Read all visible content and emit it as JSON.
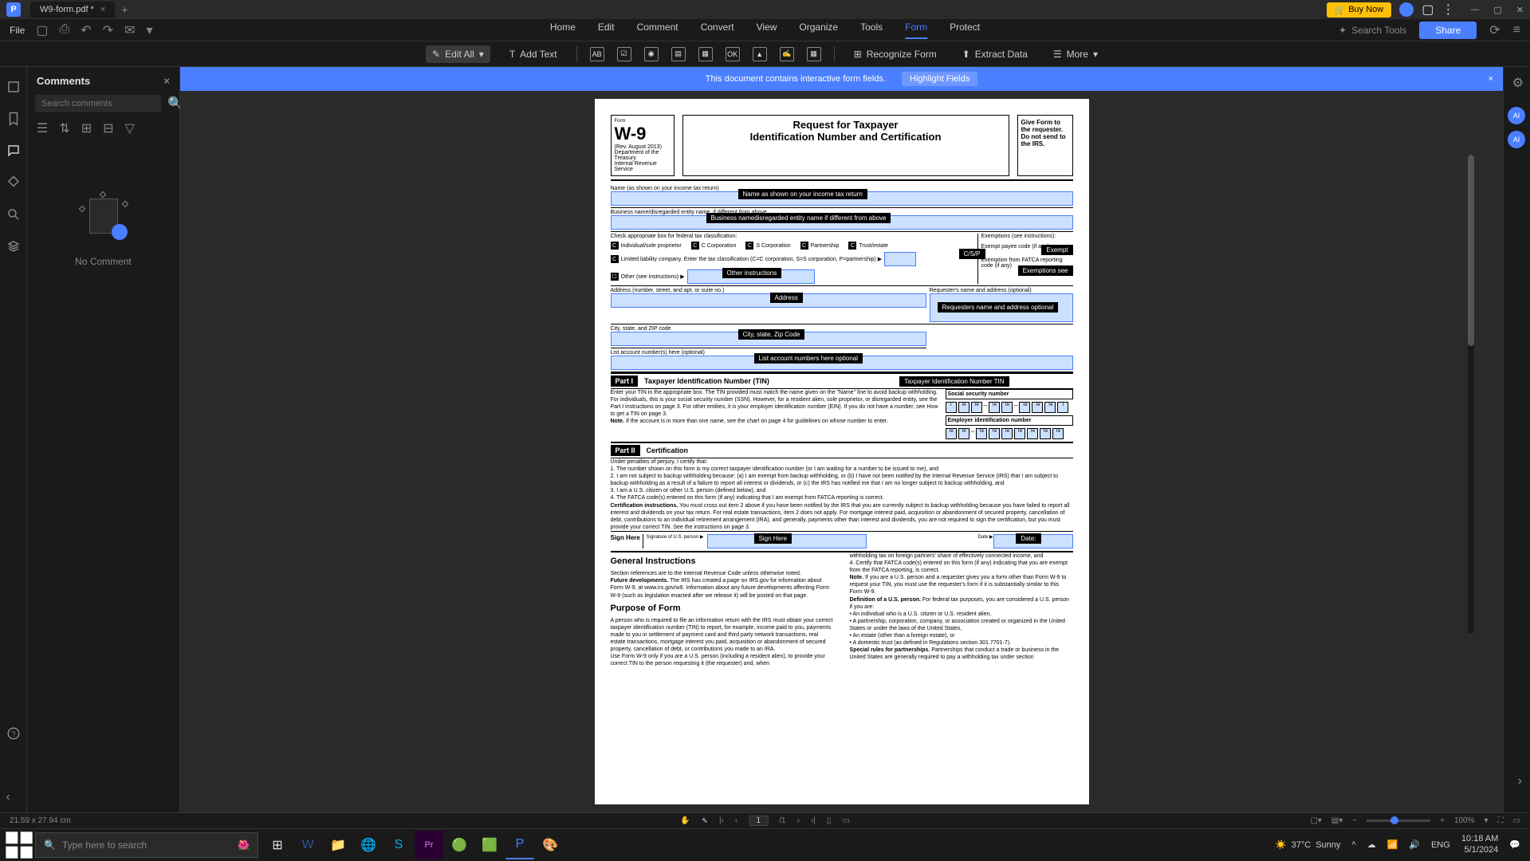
{
  "app": {
    "name": "P"
  },
  "tab": {
    "title": "W9-form.pdf *"
  },
  "titlebar": {
    "buy_now": "Buy Now"
  },
  "menu": {
    "file": "File",
    "items": [
      "Home",
      "Edit",
      "Comment",
      "Convert",
      "View",
      "Organize",
      "Tools",
      "Form",
      "Protect"
    ],
    "search": "Search Tools",
    "share": "Share"
  },
  "toolbar": {
    "edit_all": "Edit All",
    "add_text": "Add Text",
    "recognize": "Recognize Form",
    "extract": "Extract Data",
    "more": "More"
  },
  "comments": {
    "title": "Comments",
    "search_placeholder": "Search comments",
    "empty": "No Comment"
  },
  "banner": {
    "text": "This document contains interactive form fields.",
    "highlight": "Highlight Fields"
  },
  "w9": {
    "form_label": "Form",
    "title": "W-9",
    "rev": "(Rev. August 2013)",
    "dept": "Department of the Treasury",
    "irs": "Internal Revenue Service",
    "request_title": "Request for Taxpayer",
    "request_sub": "Identification Number and Certification",
    "give_form": "Give Form to the requester. Do not send to the IRS.",
    "name_label": "Name (as shown on your income tax return)",
    "name_tooltip": "Name as shown on your income tax return",
    "business_label": "Business name/disregarded entity name, if different from above",
    "business_tooltip": "Business namedisregarded entity name if different from above",
    "check_label": "Check appropriate box for federal tax classification:",
    "cb_individual": "Individual/sole proprietor",
    "cb_ccorp": "C Corporation",
    "cb_scorp": "S Corporation",
    "cb_partnership": "Partnership",
    "cb_trust": "Trust/estate",
    "exemptions": "Exemptions (see instructions):",
    "exempt_payee": "Exempt payee code (if any)",
    "exempt_tooltip": "Exempt",
    "llc_label": "Limited liability company. Enter the tax classification (C=C corporation, S=S corporation, P=partnership) ▶",
    "csp_tooltip": "C/S/P",
    "fatca": "Exemption from FATCA reporting code (if any)",
    "fatca_tooltip": "Exemptions see",
    "other_label": "Other (see instructions) ▶",
    "other_tooltip": "Other instructions",
    "address_label": "Address (number, street, and apt. or suite no.)",
    "address_tooltip": "Address",
    "requester_label": "Requester's name and address (optional)",
    "requester_tooltip": "Requesters name and address optional",
    "city_label": "City, state, and ZIP code",
    "city_tooltip": "City, state, Zip Code",
    "list_label": "List account number(s) here (optional)",
    "list_tooltip": "List account numbers here optional",
    "part1": "Part I",
    "part1_title": "Taxpayer Identification Number (TIN)",
    "tin_tooltip": "Taxpayer Identification Number TIN",
    "ssn_label": "Social security number",
    "tin_text": "Enter your TIN in the appropriate box. The TIN provided must match the name given on the \"Name\" line to avoid backup withholding. For individuals, this is your social security number (SSN). However, for a resident alien, sole proprietor, or disregarded entity, see the Part I instructions on page 3. For other entities, it is your employer identification number (EIN). If you do not have a number, see How to get a TIN on page 3.",
    "ein_label": "Employer identification number",
    "note_label": "Note.",
    "note_text": "If the account is in more than one name, see the chart on page 4 for guidelines on whose number to enter.",
    "part2": "Part II",
    "part2_title": "Certification",
    "cert_intro": "Under penalties of perjury, I certify that:",
    "cert1": "1.  The number shown on this form is my correct taxpayer identification number (or I am waiting for a number to be issued to me), and",
    "cert2": "2.  I am not subject to backup withholding because: (a) I am exempt from backup withholding, or (b) I have not been notified by the Internal Revenue Service (IRS) that I am subject to backup withholding as a result of a failure to report all interest or dividends, or (c) the IRS has notified me that I am no longer subject to backup withholding, and",
    "cert3": "3.  I am a U.S. citizen or other U.S. person (defined below), and",
    "cert4": "4.  The FATCA code(s) entered on this form (if any) indicating that I am exempt from FATCA reporting is correct.",
    "cert_instr_label": "Certification instructions.",
    "cert_instr": "You must cross out item 2 above if you have been notified by the IRS that you are currently subject to backup withholding because you have failed to report all interest and dividends on your tax return. For real estate transactions, item 2 does not apply. For mortgage interest paid, acquisition or abandonment of secured property, cancellation of debt, contributions to an individual retirement arrangement (IRA), and generally, payments other than interest and dividends, you are not required to sign the certification, but you must provide your correct TIN. See the instructions on page 3.",
    "sign_here": "Sign Here",
    "sign_of": "Signature of U.S. person ▶",
    "sign_tooltip": "Sign Here",
    "date_label": "Date ▶",
    "date_tooltip": "Date:",
    "gen_instr": "General Instructions",
    "section_ref": "Section references are to the Internal Revenue Code unless otherwise noted.",
    "future_label": "Future developments.",
    "future": "The IRS has created a page on IRS.gov for information about Form W-9, at www.irs.gov/w9. Information about any future developments affecting Form W-9 (such as legislation enacted after we release it) will be posted on that page.",
    "purpose": "Purpose of Form",
    "purpose_text": "A person who is required to file an information return with the IRS must obtain your correct taxpayer identification number (TIN) to report, for example, income paid to you, payments made to you in settlement of payment card and third party network transactions, real estate transactions, mortgage interest you paid, acquisition or abandonment of secured property, cancellation of debt, or contributions you made to an IRA.",
    "use_w9": "Use Form W-9 only if you are a U.S. person (including a resident alien), to provide your correct TIN to the person requesting it (the requester) and, when",
    "col2_a": "withholding tax on foreign partners' share of effectively connected income, and",
    "col2_4": "4. Certify that FATCA code(s) entered on this form (if any) indicating that you are exempt from the FATCA reporting, is correct.",
    "col2_note_label": "Note.",
    "col2_note": "If you are a U.S. person and a requester gives you a form other than Form W-9 to request your TIN, you must use the requester's form if it is substantially similar to this Form W-9.",
    "def_label": "Definition of a U.S. person.",
    "def": "For federal tax purposes, you are considered a U.S. person if you are:",
    "def1": "• An individual who is a U.S. citizen or U.S. resident alien,",
    "def2": "• A partnership, corporation, company, or association created or organized in the United States or under the laws of the United States,",
    "def3": "• An estate (other than a foreign estate), or",
    "def4": "• A domestic trust (as defined in Regulations section 301.7701-7).",
    "special_label": "Special rules for partnerships.",
    "special": "Partnerships that conduct a trade or business in the United States are generally required to pay a withholding tax under section"
  },
  "status": {
    "dimensions": "21.59 x 27.94 cm",
    "page_current": "1",
    "page_total": "/1",
    "zoom": "100%"
  },
  "taskbar": {
    "search": "Type here to search",
    "weather_temp": "37°C",
    "weather_cond": "Sunny",
    "lang": "ENG",
    "time": "10:18 AM",
    "date": "5/1/2024"
  }
}
